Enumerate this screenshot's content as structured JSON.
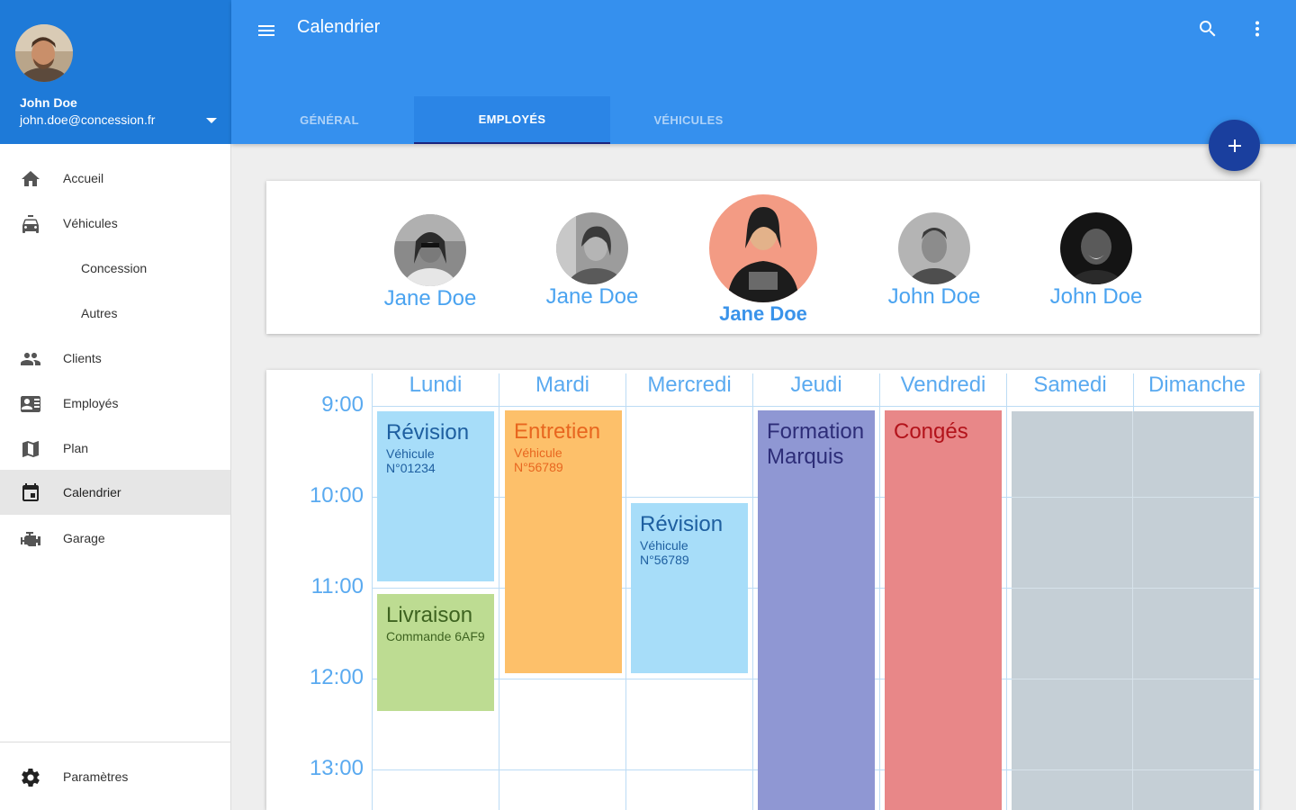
{
  "user": {
    "name": "John Doe",
    "email": "john.doe@concession.fr"
  },
  "nav": {
    "items": [
      {
        "label": "Accueil"
      },
      {
        "label": "Véhicules"
      },
      {
        "label": "Concession"
      },
      {
        "label": "Autres"
      },
      {
        "label": "Clients"
      },
      {
        "label": "Employés"
      },
      {
        "label": "Plan"
      },
      {
        "label": "Calendrier"
      },
      {
        "label": "Garage"
      }
    ],
    "settings": "Paramètres"
  },
  "topbar": {
    "title": "Calendrier"
  },
  "tabs": [
    {
      "label": "GÉNÉRAL"
    },
    {
      "label": "EMPLOYÉS"
    },
    {
      "label": "VÉHICULES"
    }
  ],
  "employees": [
    {
      "name": "Jane Doe"
    },
    {
      "name": "Jane Doe"
    },
    {
      "name": "Jane Doe",
      "selected": true
    },
    {
      "name": "John Doe"
    },
    {
      "name": "John Doe"
    }
  ],
  "calendar": {
    "days": [
      "Lundi",
      "Mardi",
      "Mercredi",
      "Jeudi",
      "Vendredi",
      "Samedi",
      "Dimanche"
    ],
    "times": [
      "9:00",
      "10:00",
      "11:00",
      "12:00",
      "13:00"
    ],
    "events": [
      {
        "title": "Révision",
        "subtitle": "Véhicule N°01234",
        "color": "#a7ddf9",
        "text_color": "#1e5fa0"
      },
      {
        "title": "Livraison",
        "subtitle": "Commande 6AF9",
        "color": "#bddc92",
        "text_color": "#3e6320"
      },
      {
        "title": "Entretien",
        "subtitle": "Véhicule N°56789",
        "color": "#fdc06a",
        "text_color": "#e8661f"
      },
      {
        "title": "Révision",
        "subtitle": "Véhicule N°56789",
        "color": "#a7ddf9",
        "text_color": "#1e5fa0"
      },
      {
        "title": "Formation Marquis",
        "color": "#8f97d3",
        "text_color": "#2d2d78"
      },
      {
        "title": "Congés",
        "color": "#e88788",
        "text_color": "#b3131b"
      },
      {
        "title": "",
        "color": "#c5cfd6"
      }
    ]
  },
  "colors": {
    "primary": "#3590ee",
    "primary_dark": "#1e7ad8",
    "fab": "#1a3f9e",
    "accent_text": "#4aa3f0"
  }
}
